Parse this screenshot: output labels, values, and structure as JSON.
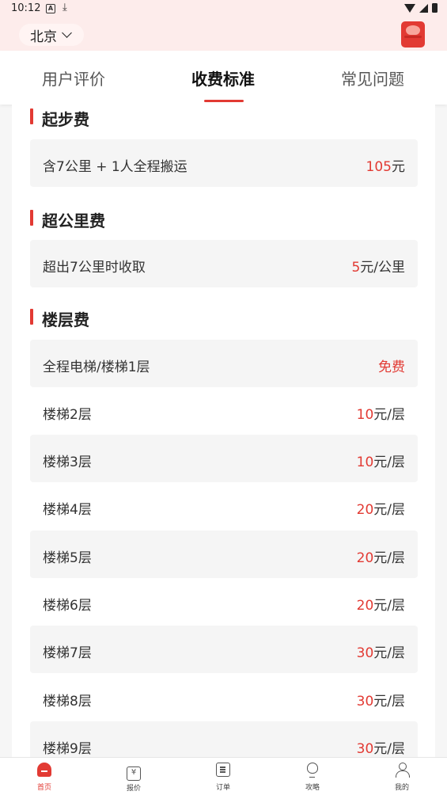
{
  "status": {
    "time": "10:12",
    "a_icon": "A",
    "download_icon": "⤓"
  },
  "header": {
    "city": "北京"
  },
  "tabs": [
    {
      "label": "用户评价"
    },
    {
      "label": "收费标准"
    },
    {
      "label": "常见问题"
    }
  ],
  "sections": {
    "start": {
      "title": "起步费",
      "rows": [
        {
          "label": "含7公里 + 1人全程搬运",
          "num": "105",
          "unit": "元"
        }
      ]
    },
    "over": {
      "title": "超公里费",
      "rows": [
        {
          "label": "超出7公里时收取",
          "num": "5",
          "unit": "元/公里"
        }
      ]
    },
    "floor": {
      "title": "楼层费",
      "rows": [
        {
          "label": "全程电梯/楼梯1层",
          "num": "免费",
          "unit": ""
        },
        {
          "label": "楼梯2层",
          "num": "10",
          "unit": "元/层"
        },
        {
          "label": "楼梯3层",
          "num": "10",
          "unit": "元/层"
        },
        {
          "label": "楼梯4层",
          "num": "20",
          "unit": "元/层"
        },
        {
          "label": "楼梯5层",
          "num": "20",
          "unit": "元/层"
        },
        {
          "label": "楼梯6层",
          "num": "20",
          "unit": "元/层"
        },
        {
          "label": "楼梯7层",
          "num": "30",
          "unit": "元/层"
        },
        {
          "label": "楼梯8层",
          "num": "30",
          "unit": "元/层"
        },
        {
          "label": "楼梯9层",
          "num": "30",
          "unit": "元/层"
        }
      ]
    }
  },
  "nav": [
    {
      "label": "首页"
    },
    {
      "label": "报价",
      "glyph": "¥"
    },
    {
      "label": "订单"
    },
    {
      "label": "攻略"
    },
    {
      "label": "我的"
    }
  ],
  "colors": {
    "accent": "#e23a33",
    "header_bg": "#fdeceb"
  }
}
